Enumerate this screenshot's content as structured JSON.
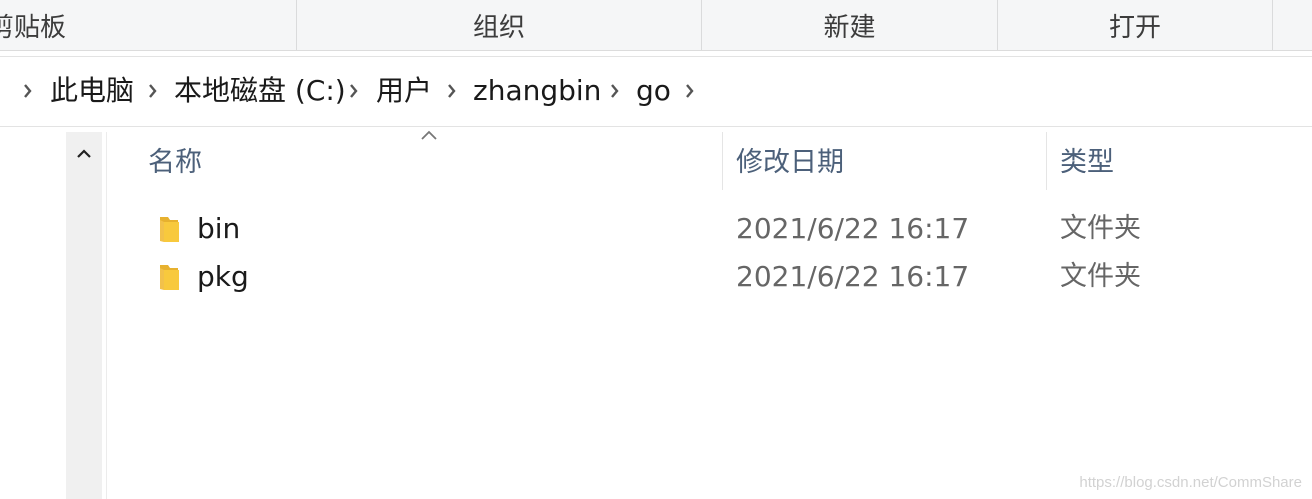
{
  "ribbon": {
    "groups": [
      "剪贴板",
      "组织",
      "新建",
      "打开"
    ]
  },
  "address": {
    "crumbs": [
      "此电脑",
      "本地磁盘 (C:)",
      "用户",
      "zhangbin",
      "go"
    ]
  },
  "columns": {
    "name": "名称",
    "modified": "修改日期",
    "type": "类型",
    "sorted_by": "name",
    "sort_direction": "ascending"
  },
  "files": [
    {
      "name": "bin",
      "modified": "2021/6/22 16:17",
      "type": "文件夹",
      "icon": "folder-icon"
    },
    {
      "name": "pkg",
      "modified": "2021/6/22 16:17",
      "type": "文件夹",
      "icon": "folder-icon"
    }
  ],
  "watermark": "https://blog.csdn.net/CommShare",
  "colors": {
    "folder": "#f8c93d",
    "header_text": "#4c607a",
    "secondary_text": "#666666"
  }
}
